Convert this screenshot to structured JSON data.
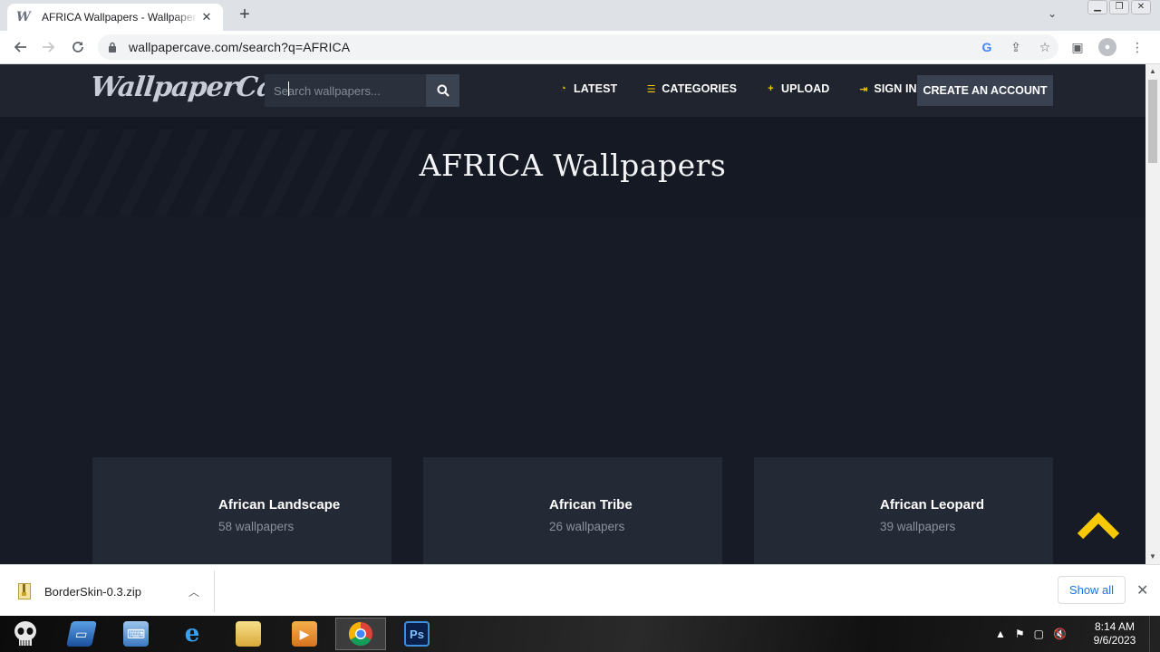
{
  "browser": {
    "tab_title": "AFRICA Wallpapers - Wallpaper C",
    "tab_favicon": "W",
    "url": "wallpapercave.com/search?q=AFRICA"
  },
  "site": {
    "logo": "WallpaperCave",
    "search_placeholder": "Search wallpapers...",
    "nav": [
      {
        "label": "LATEST",
        "icon": "clock-icon",
        "glyph": "◔"
      },
      {
        "label": "CATEGORIES",
        "icon": "list-icon",
        "glyph": "☰"
      },
      {
        "label": "UPLOAD",
        "icon": "plus-icon",
        "glyph": "+"
      },
      {
        "label": "SIGN IN",
        "icon": "sign-in-icon",
        "glyph": "⇥"
      }
    ],
    "create_account": "CREATE AN ACCOUNT",
    "accent_color": "#f6c800"
  },
  "hero": {
    "title": "AFRICA Wallpapers"
  },
  "cards": [
    {
      "title": "African Landscape",
      "count": "58 wallpapers"
    },
    {
      "title": "African Tribe",
      "count": "26 wallpapers"
    },
    {
      "title": "African Leopard",
      "count": "39 wallpapers"
    }
  ],
  "downloads": {
    "file": "BorderSkin-0.3.zip",
    "show_all": "Show all"
  },
  "taskbar": {
    "time": "8:14 AM",
    "date": "9/6/2023"
  }
}
